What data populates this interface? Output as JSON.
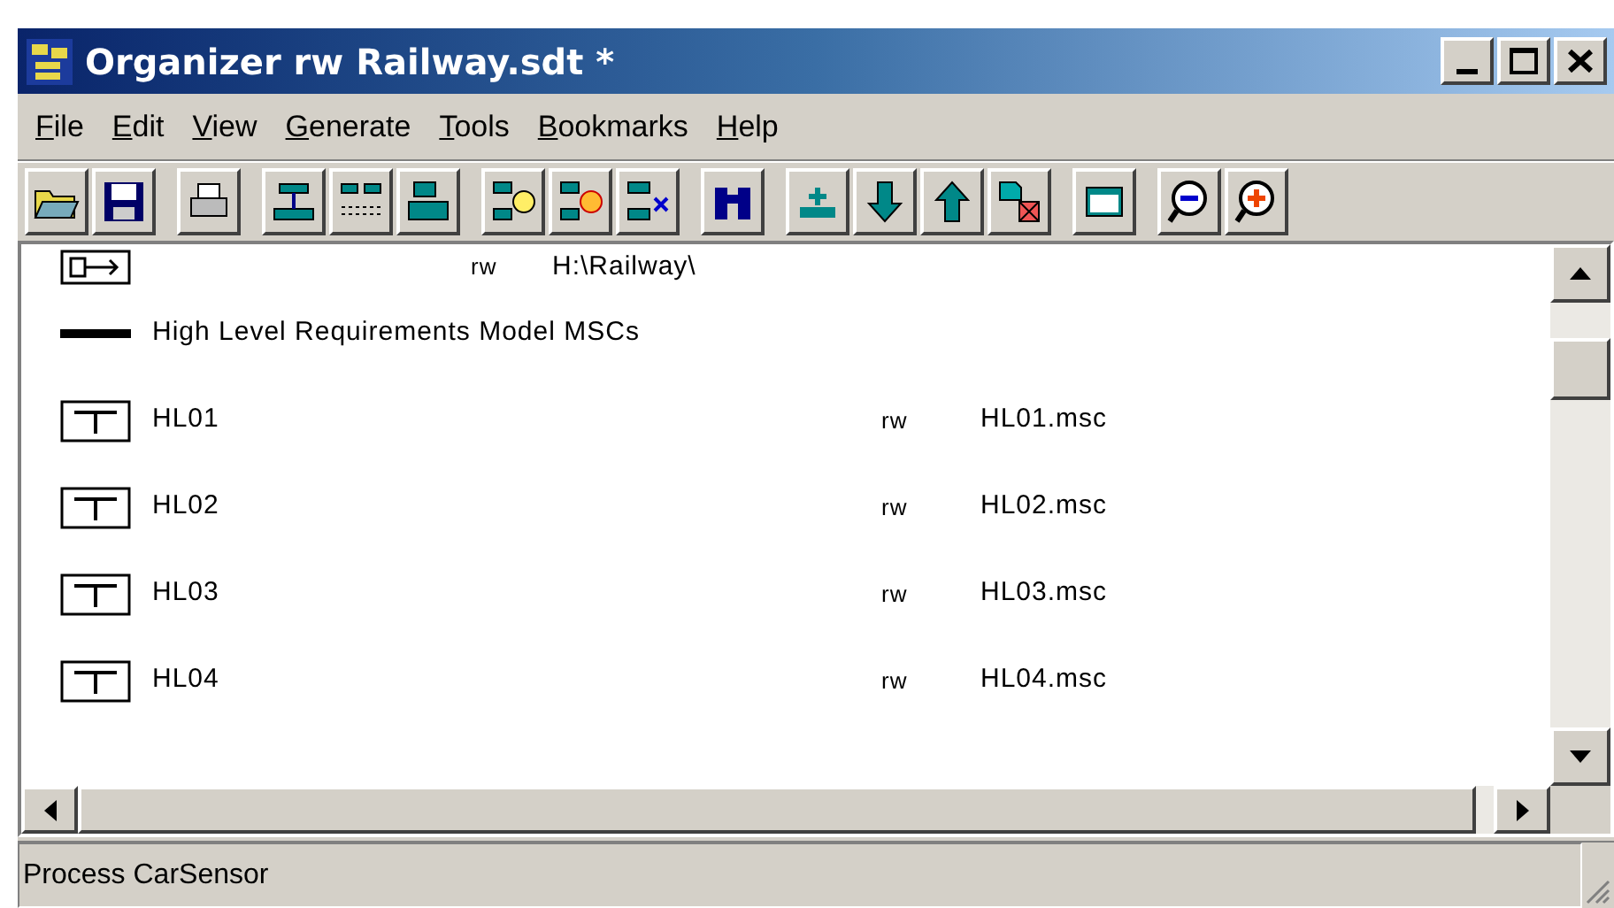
{
  "window": {
    "title": "Organizer rw Railway.sdt *"
  },
  "menu": [
    "File",
    "Edit",
    "View",
    "Generate",
    "Tools",
    "Bookmarks",
    "Help"
  ],
  "rows": [
    {
      "kind": "root",
      "access": "rw",
      "path": "H:\\Railway\\"
    },
    {
      "kind": "section",
      "label": "High Level Requirements Model MSCs"
    },
    {
      "kind": "msc",
      "name": "HL01",
      "access": "rw",
      "file": "HL01.msc"
    },
    {
      "kind": "msc",
      "name": "HL02",
      "access": "rw",
      "file": "HL02.msc"
    },
    {
      "kind": "msc",
      "name": "HL03",
      "access": "rw",
      "file": "HL03.msc"
    },
    {
      "kind": "msc",
      "name": "HL04",
      "access": "rw",
      "file": "HL04.msc"
    }
  ],
  "status_bar": "Process CarSensor"
}
